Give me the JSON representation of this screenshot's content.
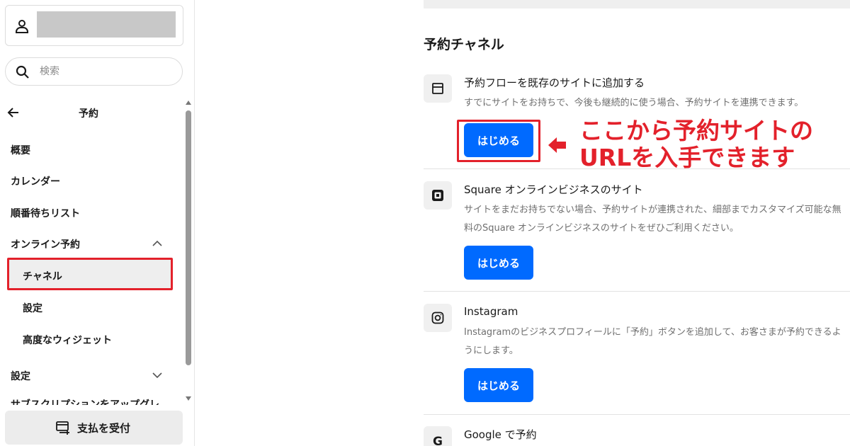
{
  "sidebar": {
    "search": {
      "placeholder": "検索"
    },
    "nav_title": "予約",
    "items": {
      "overview": "概要",
      "calendar": "カレンダー",
      "waitlist": "順番待ちリスト",
      "online_booking": "オンライン予約",
      "channels": "チャネル",
      "online_settings": "設定",
      "advanced_widgets": "高度なウィジェット",
      "settings": "設定",
      "upgrade_cut": "サブスクリプションをアップグレ"
    },
    "pay_button": "支払を受付"
  },
  "main": {
    "section_title": "予約チャネル",
    "channels": [
      {
        "icon": "storefront-icon",
        "title": "予約フローを既存のサイトに追加する",
        "description": "すでにサイトをお持ちで、今後も継続的に使う場合、予約サイトを連携できます。",
        "button": "はじめる"
      },
      {
        "icon": "square-logo-icon",
        "title": "Square オンラインビジネスのサイト",
        "description": "サイトをまだお持ちでない場合、予約サイトが連携された、細部までカスタマイズ可能な無料のSquare オンラインビジネスのサイトをぜひご利用ください。",
        "button": "はじめる"
      },
      {
        "icon": "instagram-icon",
        "title": "Instagram",
        "description": "Instagramのビジネスプロフィールに「予約」ボタンを追加して、お客さまが予約できるようにします。",
        "button": "はじめる"
      },
      {
        "icon": "google-icon",
        "title": "Google で予約"
      }
    ]
  },
  "annotation": {
    "line1": "ここから予約サイトの",
    "line2": "URLを入手できます",
    "color": "#e3212b"
  },
  "colors": {
    "primary_button": "#006aff",
    "highlight_box": "#e3212b"
  }
}
